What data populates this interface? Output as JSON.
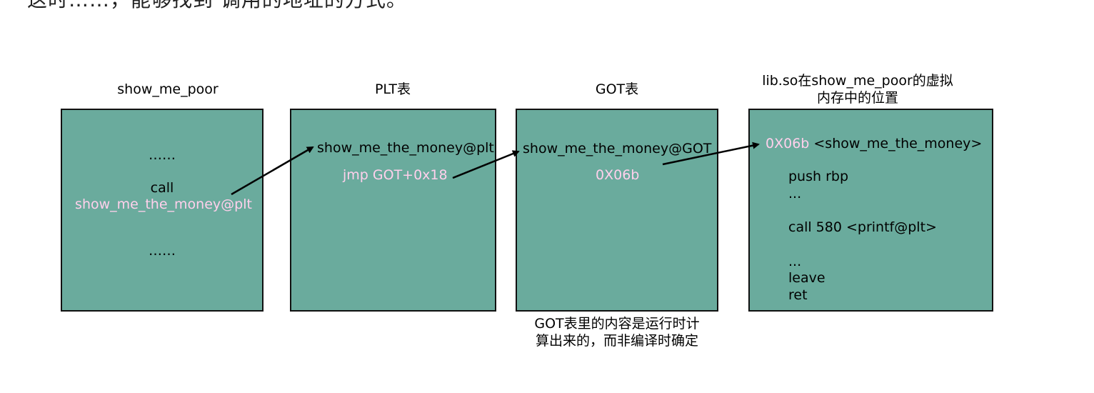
{
  "top_fragment": "这时……，能够找到 调用的地址的方式。",
  "columns": {
    "caller": {
      "title": "show_me_poor",
      "lines": [
        "……",
        "call",
        "show_me_the_money@plt",
        "……"
      ]
    },
    "plt": {
      "title": "PLT表",
      "lines": [
        "show_me_the_money@plt",
        "jmp GOT+0x18"
      ]
    },
    "got": {
      "title": "GOT表",
      "lines": [
        "show_me_the_money@GOT",
        "0X06b"
      ],
      "note_line1": "GOT表里的内容是运行时计",
      "note_line2": "算出来的，而非编译时确定"
    },
    "lib": {
      "title_line1": "lib.so在show_me_poor的虚拟",
      "title_line2": "内存中的位置",
      "addr": "0X06b",
      "symbol": "<show_me_the_money>",
      "lines": [
        "push rbp",
        "...",
        "call 580 <printf@plt>",
        "...",
        "leave",
        "ret"
      ]
    }
  },
  "colors": {
    "box_fill": "#6aab9d",
    "highlight_text": "#ffd0ec",
    "border": "#111111"
  }
}
